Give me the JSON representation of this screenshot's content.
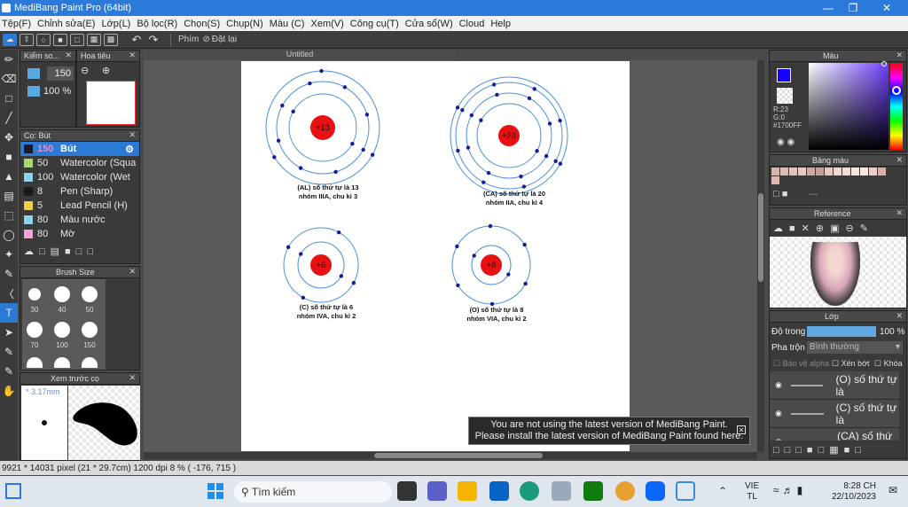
{
  "window": {
    "title": "MediBang Paint Pro (64bit)"
  },
  "menu": [
    "Tệp(F)",
    "Chỉnh sửa(E)",
    "Lớp(L)",
    "Bộ lọc(R)",
    "Chọn(S)",
    "Chụp(N)",
    "Màu (C)",
    "Xem(V)",
    "Công cụ(T)",
    "Cửa sổ(W)",
    "Cloud",
    "Help"
  ],
  "toolbar": {
    "shortcut_label": "Phím",
    "reset_label": "Đặt lại"
  },
  "brush_control": {
    "title": "Kiểm so...",
    "size": "150",
    "opacity": "100 %"
  },
  "navigator": {
    "title": "Hoa tiêu"
  },
  "brush_panel": {
    "title": "Cọ: Bút",
    "items": [
      {
        "size": "150",
        "name": "Bút",
        "color": "#1a1a2a"
      },
      {
        "size": "50",
        "name": "Watercolor (Squa",
        "color": "#a8d870"
      },
      {
        "size": "100",
        "name": "Watercolor (Wet",
        "color": "#8fd3f0"
      },
      {
        "size": "8",
        "name": "Pen (Sharp)",
        "color": "#1a1a1a"
      },
      {
        "size": "5",
        "name": "Lead Pencil (H)",
        "color": "#f0d040"
      },
      {
        "size": "80",
        "name": "Màu nước",
        "color": "#8fd3f0"
      },
      {
        "size": "80",
        "name": "Mờ",
        "color": "#f2a6d6"
      }
    ]
  },
  "brush_size": {
    "title": "Brush Size",
    "sizes": [
      "30",
      "40",
      "50",
      "70",
      "100",
      "150"
    ]
  },
  "preview": {
    "title": "Xem trước cọ",
    "size": "3.17mm"
  },
  "canvas": {
    "tab": "Untitled"
  },
  "atoms": [
    {
      "nucleus": "+13",
      "caption1": "(AL) số thứ tự là 13",
      "caption2": "nhóm IIIA, chu kì 3"
    },
    {
      "nucleus": "+20",
      "caption1": "(CA) số thứ tự là 20",
      "caption2": "nhóm IIA, chu kì 4"
    },
    {
      "nucleus": "+6",
      "caption1": "(C) số thứ tự là 6",
      "caption2": "nhóm IVA, chu kì 2"
    },
    {
      "nucleus": "+8",
      "caption1": "(O) số thứ tự là 8",
      "caption2": "nhóm VIA, chu kì 2"
    }
  ],
  "notice": {
    "line1": "You are not using the latest version of MediBang Paint.",
    "line2": "Please install the latest version of MediBang Paint found here."
  },
  "color_panel": {
    "title": "Màu",
    "r": "R:23",
    "g": "G:0",
    "hex": "#1700FF",
    "fg": "#1700ff",
    "bg": "#ffffff"
  },
  "palette": {
    "title": "Bảng màu",
    "placeholder": "---",
    "colors": [
      "#d8b4ac",
      "#dcbcb0",
      "#e4c4b8",
      "#e8ccc0",
      "#d0a8a0",
      "#c4a098",
      "#e6c8c0",
      "#f0d8d0",
      "#f4dcd4",
      "#f8e4dc",
      "#fce8e4",
      "#ecccc4",
      "#d8b0a8",
      "#e0b8b0"
    ]
  },
  "reference": {
    "title": "Reference"
  },
  "layers": {
    "title": "Lớp",
    "opacity_label": "Độ trong",
    "opacity_value": "100 %",
    "blend_label": "Pha trộn",
    "blend_value": "Bình thường",
    "protect_alpha": "Bảo vệ alpha",
    "clipping": "Xén bớt",
    "lock": "Khóa",
    "items": [
      "(O) số thứ tự là",
      "(C) số thứ tự là",
      "(CA) số thứ tự"
    ]
  },
  "status": {
    "text": "9921 * 14031 pixel   (21 * 29.7cm)   1200 dpi   8 %   ( -176, 715 )"
  },
  "taskbar": {
    "search": "Tìm kiếm",
    "lang1": "VIE",
    "lang2": "TL",
    "time": "8:28 CH",
    "date": "22/10/2023"
  }
}
